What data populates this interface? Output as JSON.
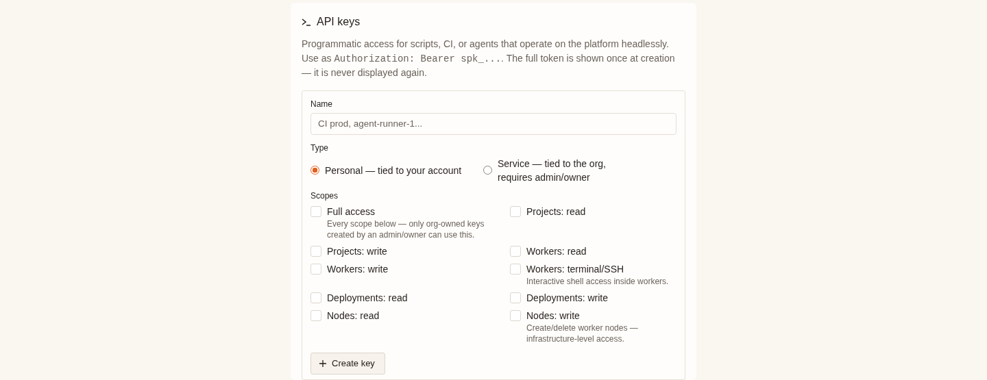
{
  "section": {
    "title": "API keys",
    "description": [
      {
        "kind": "text",
        "text": "Programmatic access for scripts, CI, or agents that operate on the platform headlessly. Use as "
      },
      {
        "kind": "code",
        "text": "Authorization: Bearer spk_..."
      },
      {
        "kind": "text",
        "text": ". The full token is shown once at creation — it is never displayed again."
      }
    ]
  },
  "form": {
    "name_label": "Name",
    "name_placeholder": "CI prod, agent-runner-1...",
    "type_label": "Type",
    "types": [
      {
        "label": "Personal — tied to your account",
        "selected": true
      },
      {
        "label": "Service — tied to the org, requires admin/owner",
        "selected": false
      }
    ],
    "scopes_label": "Scopes",
    "scopes": [
      {
        "label": "Full access",
        "hint": "Every scope below — only org-owned keys created by an admin/owner can use this.",
        "checked": false
      },
      {
        "label": "Projects: read",
        "checked": false
      },
      {
        "label": "Projects: write",
        "checked": false
      },
      {
        "label": "Workers: read",
        "checked": false
      },
      {
        "label": "Workers: write",
        "checked": false
      },
      {
        "label": "Workers: terminal/SSH",
        "hint": "Interactive shell access inside workers.",
        "checked": false
      },
      {
        "label": "Deployments: read",
        "checked": false
      },
      {
        "label": "Deployments: write",
        "checked": false
      },
      {
        "label": "Nodes: read",
        "checked": false
      },
      {
        "label": "Nodes: write",
        "hint": "Create/delete worker nodes — infrastructure-level access.",
        "checked": false
      }
    ],
    "submit": "Create key"
  }
}
